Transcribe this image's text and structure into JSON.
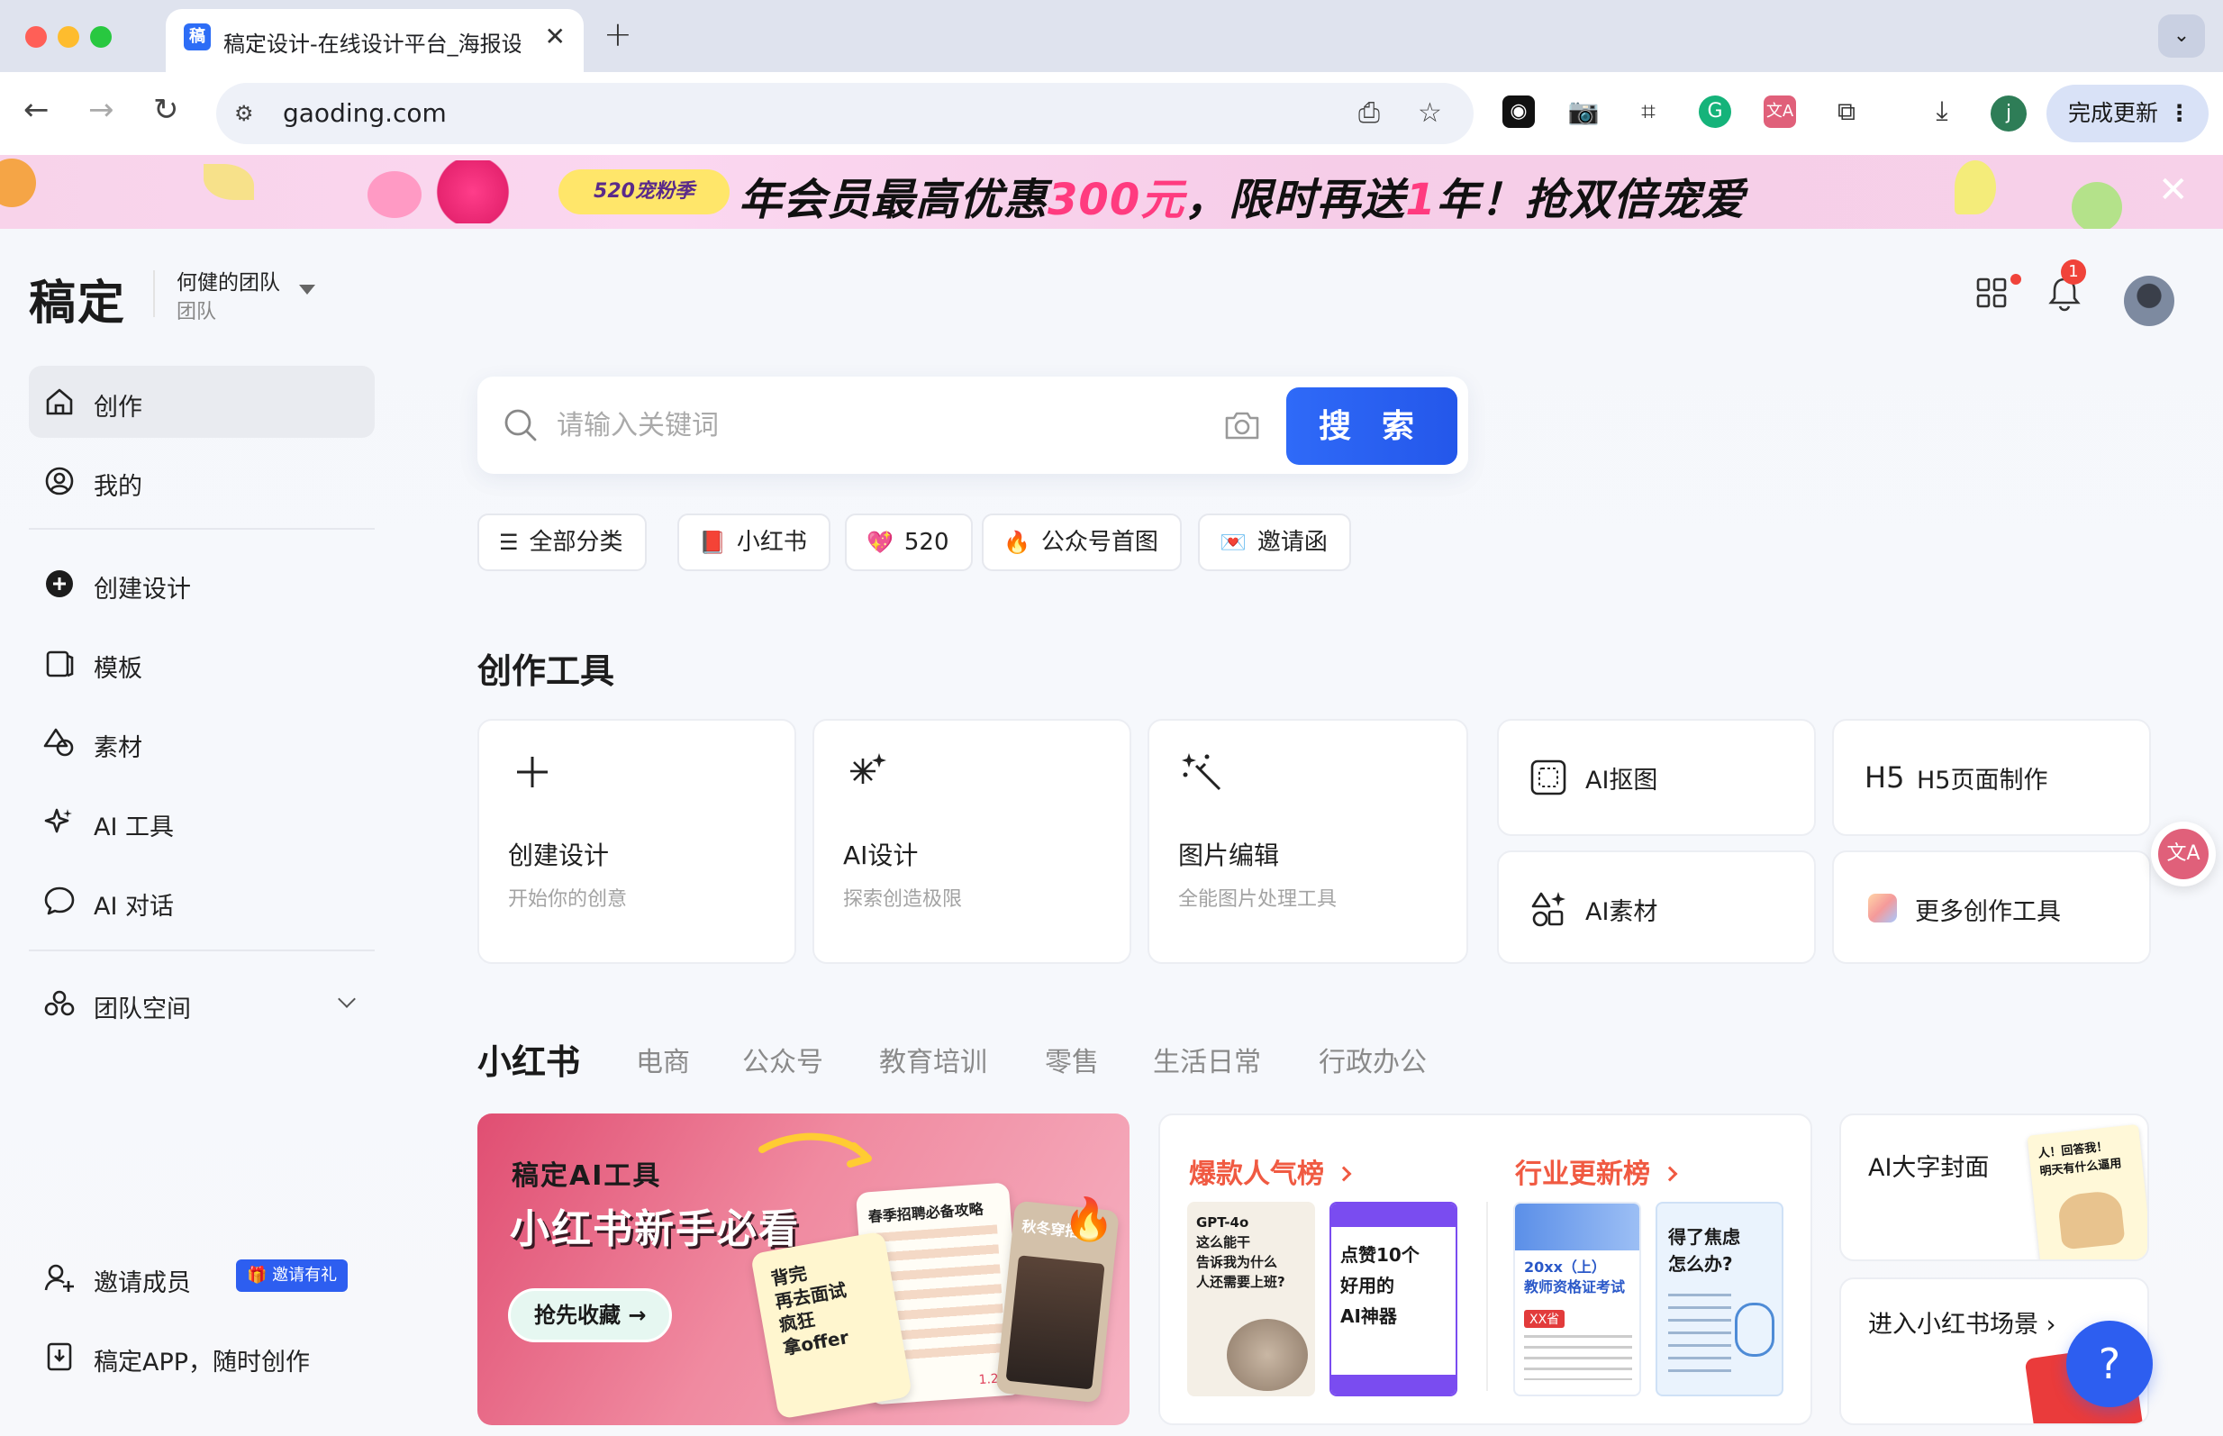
{
  "browser": {
    "tab_title": "稿定设计-在线设计平台_海报设",
    "tab_favicon": "稿",
    "url": "gaoding.com",
    "profile_initial": "j",
    "update_label": "完成更新"
  },
  "promo": {
    "badge": "520宠粉季",
    "text_a": "年会员最高优惠",
    "text_b": "300元",
    "text_c": "，限时再送",
    "text_d": "1",
    "text_e": "年！抢双倍宠爱"
  },
  "header": {
    "logo": "稿定",
    "team_name": "何健的团队",
    "team_type": "团队",
    "notification_count": "1"
  },
  "sidebar": {
    "items": [
      {
        "label": "创作"
      },
      {
        "label": "我的"
      },
      {
        "label": "创建设计"
      },
      {
        "label": "模板"
      },
      {
        "label": "素材"
      },
      {
        "label": "AI 工具"
      },
      {
        "label": "AI 对话"
      },
      {
        "label": "团队空间"
      }
    ],
    "invite_label": "邀请成员",
    "invite_tag": "邀请有礼",
    "app_label": "稿定APP，随时创作"
  },
  "search": {
    "placeholder": "请输入关键词",
    "button": "搜 索"
  },
  "chips": [
    {
      "icon": "☰",
      "label": "全部分类"
    },
    {
      "icon": "📕",
      "label": "小红书"
    },
    {
      "icon": "💖",
      "label": "520"
    },
    {
      "icon": "🔥",
      "label": "公众号首图"
    },
    {
      "icon": "💌",
      "label": "邀请函"
    }
  ],
  "tools": {
    "title": "创作工具",
    "big": [
      {
        "title": "创建设计",
        "sub": "开始你的创意"
      },
      {
        "title": "AI设计",
        "sub": "探索创造极限"
      },
      {
        "title": "图片编辑",
        "sub": "全能图片处理工具"
      }
    ],
    "small": [
      {
        "label": "AI抠图"
      },
      {
        "label": "H5页面制作"
      },
      {
        "label": "AI素材"
      },
      {
        "label": "更多创作工具"
      }
    ]
  },
  "categories": [
    "小红书",
    "电商",
    "公众号",
    "教育培训",
    "零售",
    "生活日常",
    "行政办公"
  ],
  "hero": {
    "line1": "稿定AI工具",
    "line2": "小红书新手必看",
    "button": "抢先收藏 →",
    "card1": "背完\n再去面试\n疯狂\n拿offer",
    "card2": "春季招聘必备攻略",
    "card3": "秋冬穿搭",
    "likes": "1.2万"
  },
  "ranks": {
    "popular": "爆款人气榜",
    "industry": "行业更新榜",
    "thumb1": "GPT-4o\n这么能干\n告诉我为什么\n人还需要上班?",
    "thumb2": "点赞10个\n好用的\nAI神器",
    "thumb3": "20xx（上）\n教师资格证考试",
    "thumb3_tag": "XX省",
    "thumb4": "得了焦虑\n怎么办?"
  },
  "xhs": {
    "cover_label": "AI大字封面",
    "cover_text": "人！回答我！\n明天有什么逼用",
    "enter_label": "进入小红书场景"
  },
  "help": "?",
  "colors": {
    "accent": "#2d5ef0",
    "rank": "#f05a42",
    "promo_highlight": "#ff3b7f"
  }
}
